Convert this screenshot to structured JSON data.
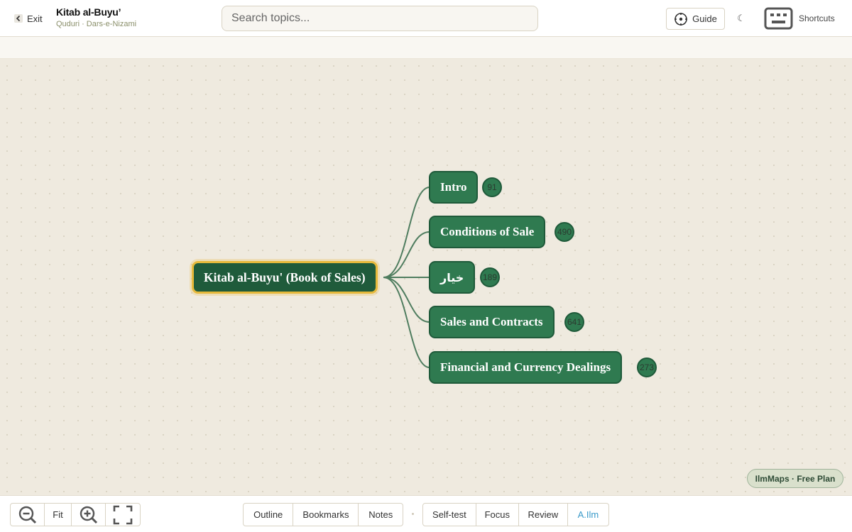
{
  "header": {
    "exit_label": "Exit",
    "title": "Kitab al-Buyu’",
    "subtitle": "Quduri · Dars-e-Nizami",
    "search_placeholder": "Search topics...",
    "guide_label": "Guide",
    "theme_icon": "☾",
    "shortcuts_label": "Shortcuts"
  },
  "mindmap": {
    "root": {
      "label": "Kitab al-Buyu' (Book of Sales)"
    },
    "children": [
      {
        "label": "Intro",
        "count": "91"
      },
      {
        "label": "Conditions of Sale",
        "count": "490"
      },
      {
        "label": "خيار",
        "count": "189"
      },
      {
        "label": "Sales and Contracts",
        "count": "641"
      },
      {
        "label": "Financial and Currency Dealings",
        "count": "273"
      }
    ]
  },
  "plan_badge": "IlmMaps · Free Plan",
  "bottombar": {
    "fit_label": "Fit",
    "panels": [
      "Outline",
      "Bookmarks",
      "Notes"
    ],
    "study": [
      "Self-test",
      "Focus",
      "Review",
      "A.Ilm"
    ]
  },
  "colors": {
    "node_fill": "#2f7a50",
    "root_fill": "#1f5b3b",
    "root_highlight": "#e6b93b",
    "connector": "#4f7d5f",
    "canvas_bg": "#efeadf",
    "ai_accent": "#3a9ac9"
  }
}
